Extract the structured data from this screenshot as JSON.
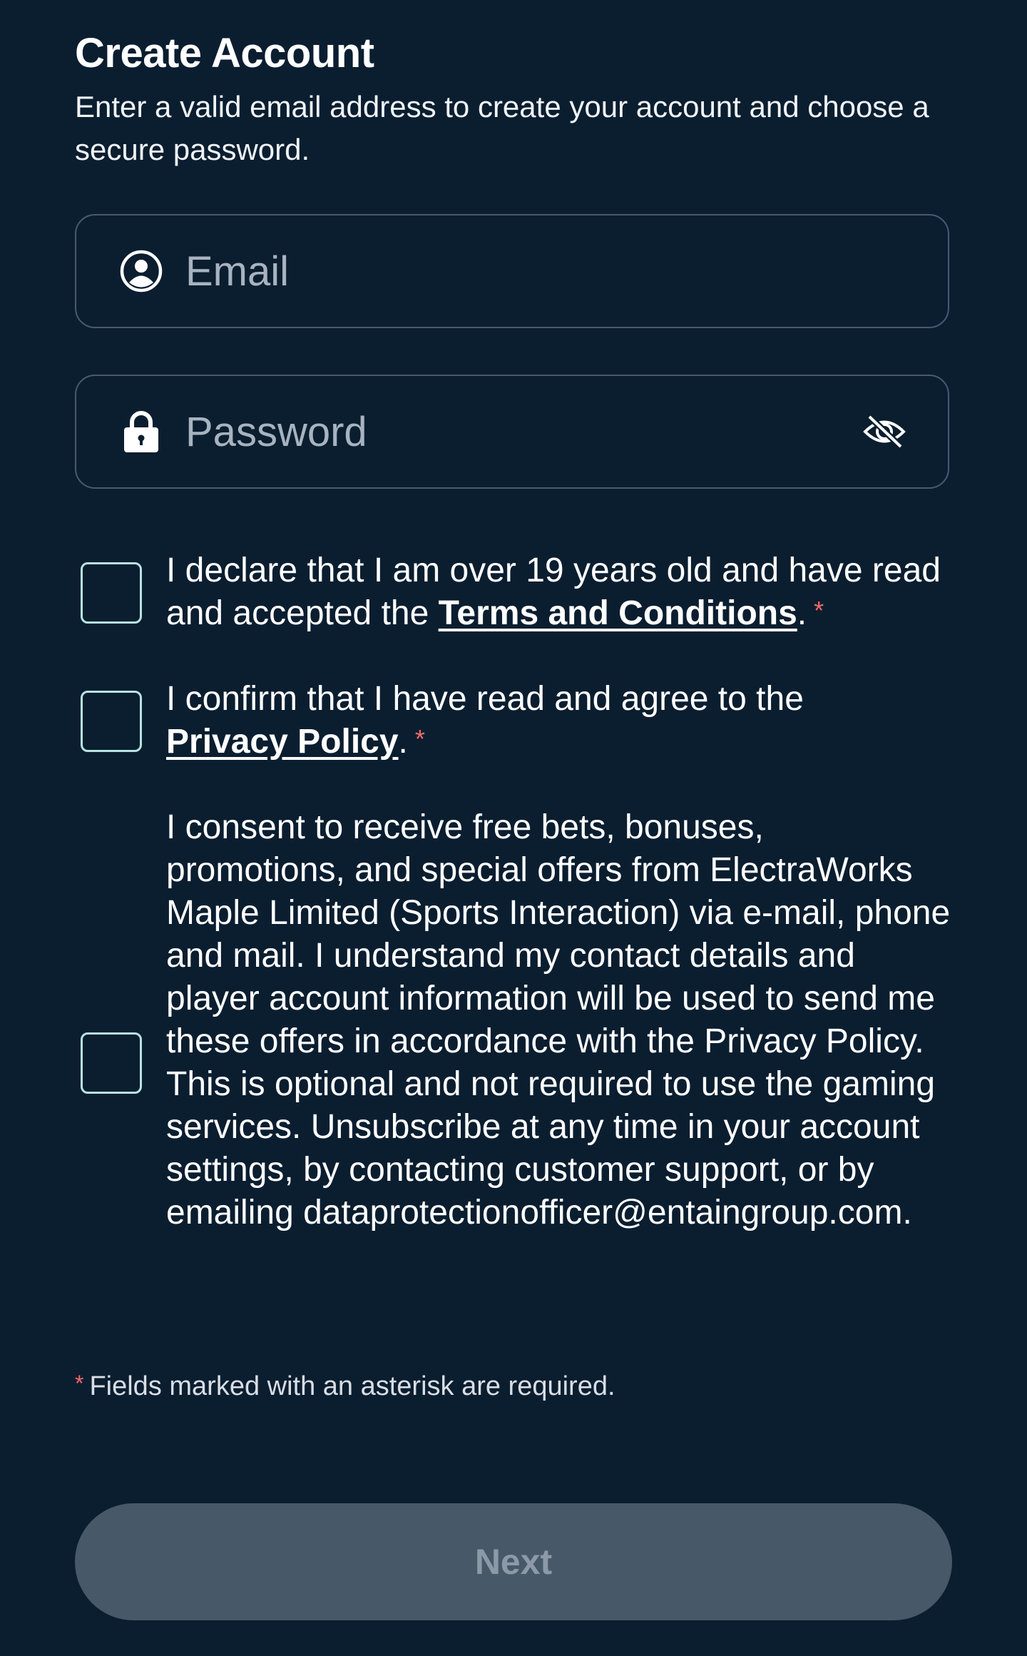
{
  "header": {
    "title": "Create Account",
    "subtitle": "Enter a valid email address to create your account and choose a secure password."
  },
  "form": {
    "email": {
      "placeholder": "Email",
      "value": "",
      "icon": "user-circle-icon"
    },
    "password": {
      "placeholder": "Password",
      "value": "",
      "icon": "lock-icon",
      "toggle_icon": "eye-slash-icon"
    }
  },
  "consents": {
    "terms": {
      "text_before": "I declare that I am over 19 years old and have read and accepted the ",
      "link_text": "Terms and Conditions",
      "text_after": ".",
      "required_marker": "*",
      "checked": false
    },
    "privacy": {
      "text_before": "I confirm that I have read and agree to the ",
      "link_text": "Privacy Policy",
      "text_after": ".",
      "required_marker": "*",
      "checked": false
    },
    "marketing": {
      "text": "I consent to receive free bets, bonuses, promotions, and special offers from ElectraWorks Maple Limited (Sports Interaction) via e-mail, phone and mail. I understand my contact details and player account information will be used to send me these offers in accordance with the Privacy Policy. This is optional and not required to use the gaming services. Unsubscribe at any time in your account settings, by contacting customer support, or by emailing dataprotectionofficer@entaingroup.com.",
      "checked": false
    }
  },
  "required_note": {
    "marker": "*",
    "text": "Fields marked with an asterisk are required."
  },
  "next_button": {
    "label": "Next",
    "enabled": false
  },
  "colors": {
    "background": "#0b1e30",
    "field_border": "#4a5a6e",
    "checkbox_border": "#b7e3e0",
    "asterisk": "#f26a6a",
    "button_disabled_bg": "#475868",
    "button_disabled_text": "#8c99a6"
  }
}
